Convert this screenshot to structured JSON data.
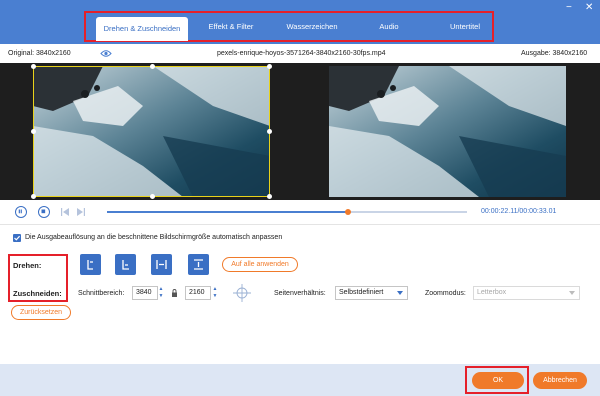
{
  "window": {
    "icon": "app-icon",
    "minimize_label": "−",
    "close_label": "✕"
  },
  "tabs": [
    {
      "label": "Drehen & Zuschneiden",
      "active": true
    },
    {
      "label": "Effekt & Filter",
      "active": false
    },
    {
      "label": "Wasserzeichen",
      "active": false
    },
    {
      "label": "Audio",
      "active": false
    },
    {
      "label": "Untertitel",
      "active": false
    }
  ],
  "info": {
    "original": "Original: 3840x2160",
    "filename": "pexels-enrique-hoyos-3571264-3840x2160-30fps.mp4",
    "output": "Ausgabe: 3840x2160"
  },
  "playback": {
    "time": "00:00:22.11/00:00:33.01",
    "progress": 0.67
  },
  "settings": {
    "checkbox_label": "Die Ausgabeauflösung an die beschnittene Bildschirmgröße automatisch anpassen",
    "checkbox_checked": true,
    "rotate_label": "Drehen:",
    "crop_label": "Zuschneiden:",
    "apply_all": "Auf alle anwenden",
    "crop_area_label": "Schnittbereich:",
    "width": "3840",
    "height": "2160",
    "aspect_label": "Seitenverhältnis:",
    "aspect_value": "Selbstdefiniert",
    "zoom_label": "Zoommodus:",
    "zoom_value": "Letterbox",
    "reset": "Zurücksetzen"
  },
  "footer": {
    "ok": "OK",
    "cancel": "Abbrechen"
  },
  "colors": {
    "accent": "#4a7fd1",
    "orange": "#f07a2a",
    "highlight": "#e5202a",
    "crop": "#e8d21b"
  }
}
